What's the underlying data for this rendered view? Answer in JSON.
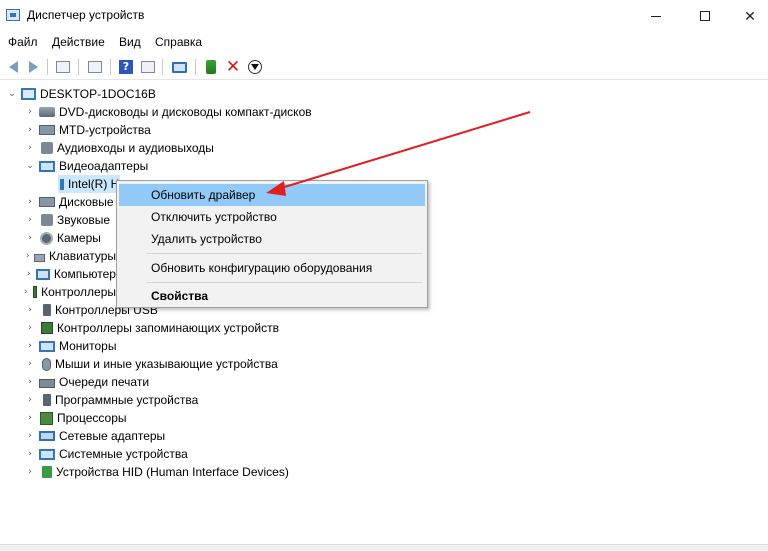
{
  "window": {
    "title": "Диспетчер устройств",
    "icon": "device-manager-icon"
  },
  "menubar": {
    "items": [
      "Файл",
      "Действие",
      "Вид",
      "Справка"
    ]
  },
  "toolbar": {
    "icons": [
      "back-arrow-icon",
      "forward-arrow-icon",
      "properties-icon",
      "driver-icon",
      "help-icon",
      "view-icon",
      "scan-hardware-icon",
      "enable-device-icon",
      "uninstall-device-icon",
      "update-driver-icon"
    ]
  },
  "tree": {
    "root": "DESKTOP-1DOC16B",
    "items": [
      {
        "label": "DVD-дисководы и дисководы компакт-дисков",
        "icon": "dvd-drive-icon"
      },
      {
        "label": "MTD-устройства",
        "icon": "mtd-device-icon"
      },
      {
        "label": "Аудиовходы и аудиовыходы",
        "icon": "audio-icon"
      },
      {
        "label": "Видеоадаптеры",
        "icon": "display-adapter-icon",
        "expanded": true
      },
      {
        "label": "Intel(R) HD Graphics",
        "icon": "display-adapter-icon",
        "child": true,
        "visible_text": "Intel(R) HD Graphic"
      },
      {
        "label": "Дисковые",
        "icon": "disk-drive-icon"
      },
      {
        "label": "Звуковые",
        "icon": "sound-icon"
      },
      {
        "label": "Камеры",
        "icon": "camera-icon"
      },
      {
        "label": "Клавиатуры",
        "icon": "keyboard-icon"
      },
      {
        "label": "Компьютер",
        "icon": "computer-icon"
      },
      {
        "label": "Контроллеры",
        "icon": "controller-icon"
      },
      {
        "label": "Контроллеры USB",
        "icon": "usb-controller-icon"
      },
      {
        "label": "Контроллеры запоминающих устройств",
        "icon": "storage-controller-icon"
      },
      {
        "label": "Мониторы",
        "icon": "monitor-icon"
      },
      {
        "label": "Мыши и иные указывающие устройства",
        "icon": "mouse-icon"
      },
      {
        "label": "Очереди печати",
        "icon": "printer-icon"
      },
      {
        "label": "Программные устройства",
        "icon": "software-device-icon"
      },
      {
        "label": "Процессоры",
        "icon": "processor-icon"
      },
      {
        "label": "Сетевые адаптеры",
        "icon": "network-adapter-icon"
      },
      {
        "label": "Системные устройства",
        "icon": "system-device-icon"
      },
      {
        "label": "Устройства HID (Human Interface Devices)",
        "icon": "hid-icon"
      }
    ]
  },
  "context_menu": {
    "items": [
      {
        "label": "Обновить драйвер",
        "highlighted": true
      },
      {
        "label": "Отключить устройство"
      },
      {
        "label": "Удалить устройство"
      },
      {
        "label": "Обновить конфигурацию оборудования"
      },
      {
        "label": "Свойства",
        "bold": true
      }
    ]
  },
  "annotation": {
    "color": "#e02020"
  }
}
